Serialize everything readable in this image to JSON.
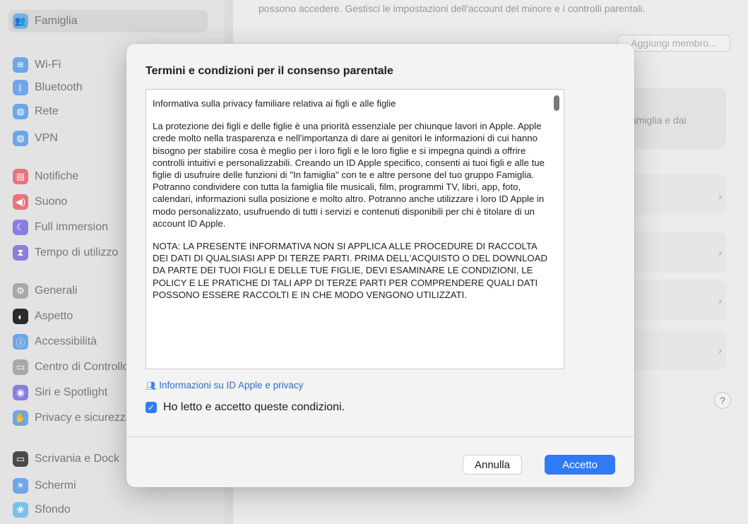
{
  "background": {
    "top_text": "possono accedere. Gestisci le impostazioni dell'account del minore e i controlli parentali.",
    "add_member": "Aggiungi membro...",
    "panel_text": "amiglia e dai",
    "help": "?",
    "chevron": "›"
  },
  "sidebar": {
    "items": [
      {
        "label": "Famiglia",
        "icon": "family-icon",
        "color": "#7bb0d9",
        "glyph": "👥"
      },
      {
        "label": "Wi-Fi",
        "icon": "wifi-icon",
        "color": "#6ea6e8",
        "glyph": "≋"
      },
      {
        "label": "Bluetooth",
        "icon": "bluetooth-icon",
        "color": "#6ea6e8",
        "glyph": "ᛒ"
      },
      {
        "label": "Rete",
        "icon": "network-icon",
        "color": "#6ea6e8",
        "glyph": "◍"
      },
      {
        "label": "VPN",
        "icon": "vpn-icon",
        "color": "#6ea6e8",
        "glyph": "◍"
      },
      {
        "label": "Notifiche",
        "icon": "notifications-icon",
        "color": "#e8747a",
        "glyph": "▤"
      },
      {
        "label": "Suono",
        "icon": "sound-icon",
        "color": "#e8747a",
        "glyph": "◀)"
      },
      {
        "label": "Full immersion",
        "icon": "focus-icon",
        "color": "#8a7fe0",
        "glyph": "☾"
      },
      {
        "label": "Tempo di utilizzo",
        "icon": "screen-time-icon",
        "color": "#8a7fe0",
        "glyph": "⧗"
      },
      {
        "label": "Generali",
        "icon": "general-icon",
        "color": "#a9a9a9",
        "glyph": "⚙"
      },
      {
        "label": "Aspetto",
        "icon": "appearance-icon",
        "color": "#2b2b2b",
        "glyph": "◐"
      },
      {
        "label": "Accessibilità",
        "icon": "accessibility-icon",
        "color": "#6ea6e8",
        "glyph": "ⓘ"
      },
      {
        "label": "Centro di Controllo",
        "icon": "control-center-icon",
        "color": "#a9a9a9",
        "glyph": "▭"
      },
      {
        "label": "Siri e Spotlight",
        "icon": "siri-icon",
        "color": "#8a7fe0",
        "glyph": "◉"
      },
      {
        "label": "Privacy e sicurezza",
        "icon": "privacy-icon",
        "color": "#6ea6e8",
        "glyph": "✋"
      },
      {
        "label": "Scrivania e Dock",
        "icon": "desktop-dock-icon",
        "color": "#4a4a4a",
        "glyph": "▭"
      },
      {
        "label": "Schermi",
        "icon": "displays-icon",
        "color": "#6ea6e8",
        "glyph": "☀"
      },
      {
        "label": "Sfondo",
        "icon": "wallpaper-icon",
        "color": "#7ac0e8",
        "glyph": "❀"
      }
    ]
  },
  "dialog": {
    "title": "Termini e condizioni per il consenso parentale",
    "terms_heading": "Informativa sulla privacy familiare relativa ai figli e alle figlie",
    "terms_paragraph_1": "La protezione dei figli e delle figlie è una priorità essenziale per chiunque lavori in Apple. Apple crede molto nella trasparenza e nell'importanza di dare ai genitori le informazioni di cui hanno bisogno per stabilire cosa è meglio per i loro figli e le loro figlie e si impegna quindi a offrire controlli intuitivi e personalizzabili. Creando un ID Apple specifico, consenti ai tuoi figli e alle tue figlie di usufruire delle funzioni di \"In famiglia\" con te e altre persone del tuo gruppo Famiglia. Potranno condividere con tutta la famiglia file musicali, film, programmi TV, libri, app, foto, calendari, informazioni sulla posizione e molto altro. Potranno anche utilizzare i loro ID Apple in modo personalizzato, usufruendo di tutti i servizi e contenuti disponibili per chi è titolare di un account ID Apple.",
    "terms_paragraph_2": "NOTA: LA PRESENTE INFORMATIVA NON SI APPLICA ALLE PROCEDURE DI RACCOLTA DEI DATI DI QUALSIASI APP DI TERZE PARTI. PRIMA DELL'ACQUISTO O DEL DOWNLOAD DA PARTE DEI TUOI FIGLI E DELLE TUE FIGLIE, DEVI ESAMINARE LE CONDIZIONI, LE POLICY E LE PRATICHE DI TALI APP DI TERZE PARTI PER COMPRENDERE QUALI DATI POSSONO ESSERE RACCOLTI E IN CHE MODO VENGONO UTILIZZATI.",
    "privacy_link": "Informazioni su ID Apple e privacy",
    "agree_label": "Ho letto e accetto queste condizioni.",
    "agree_checked": true,
    "cancel_label": "Annulla",
    "accept_label": "Accetto",
    "accent_color": "#2f7bf5"
  }
}
